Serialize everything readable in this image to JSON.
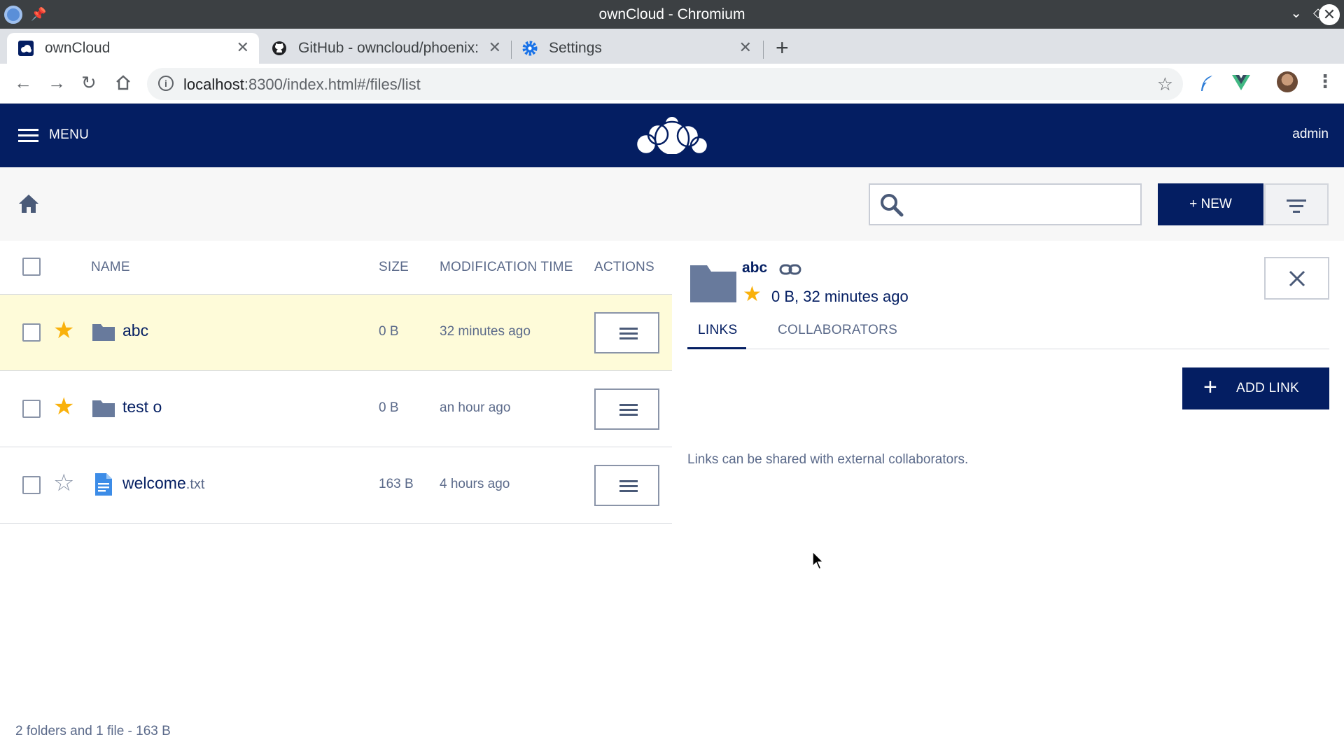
{
  "window": {
    "title": "ownCloud - Chromium"
  },
  "tabs": [
    {
      "label": "ownCloud",
      "close": "✕"
    },
    {
      "label": "GitHub - owncloud/phoenix:",
      "close": "✕"
    },
    {
      "label": "Settings",
      "close": "✕"
    }
  ],
  "newtab": "+",
  "address": {
    "host": "localhost",
    "rest": ":8300/index.html#/files/list"
  },
  "header": {
    "menu_label": "MENU",
    "user": "admin"
  },
  "toolbar": {
    "new_label": "+ NEW",
    "search_placeholder": ""
  },
  "list": {
    "columns": {
      "name": "NAME",
      "size": "SIZE",
      "mtime": "MODIFICATION TIME",
      "actions": "ACTIONS"
    },
    "rows": [
      {
        "name": "abc",
        "ext": "",
        "size": "0 B",
        "mtime": "32 minutes ago",
        "starred": true,
        "type": "folder-icon"
      },
      {
        "name": "test o",
        "ext": "",
        "size": "0 B",
        "mtime": "an hour ago",
        "starred": true,
        "type": "folder-icon"
      },
      {
        "name": "welcome",
        "ext": ".txt",
        "size": "163 B",
        "mtime": "4 hours ago",
        "starred": false,
        "type": "text-file-icon"
      }
    ],
    "summary": "2 folders and 1 file - 163 B"
  },
  "panel": {
    "name": "abc",
    "meta": "0 B, 32 minutes ago",
    "tabs": {
      "links": "LINKS",
      "collaborators": "COLLABORATORS"
    },
    "add_link": "ADD LINK",
    "note": "Links can be shared with external collaborators."
  },
  "colors": {
    "brand": "#041e62",
    "star": "#f9b10c",
    "selected_row": "#fefbd9"
  }
}
